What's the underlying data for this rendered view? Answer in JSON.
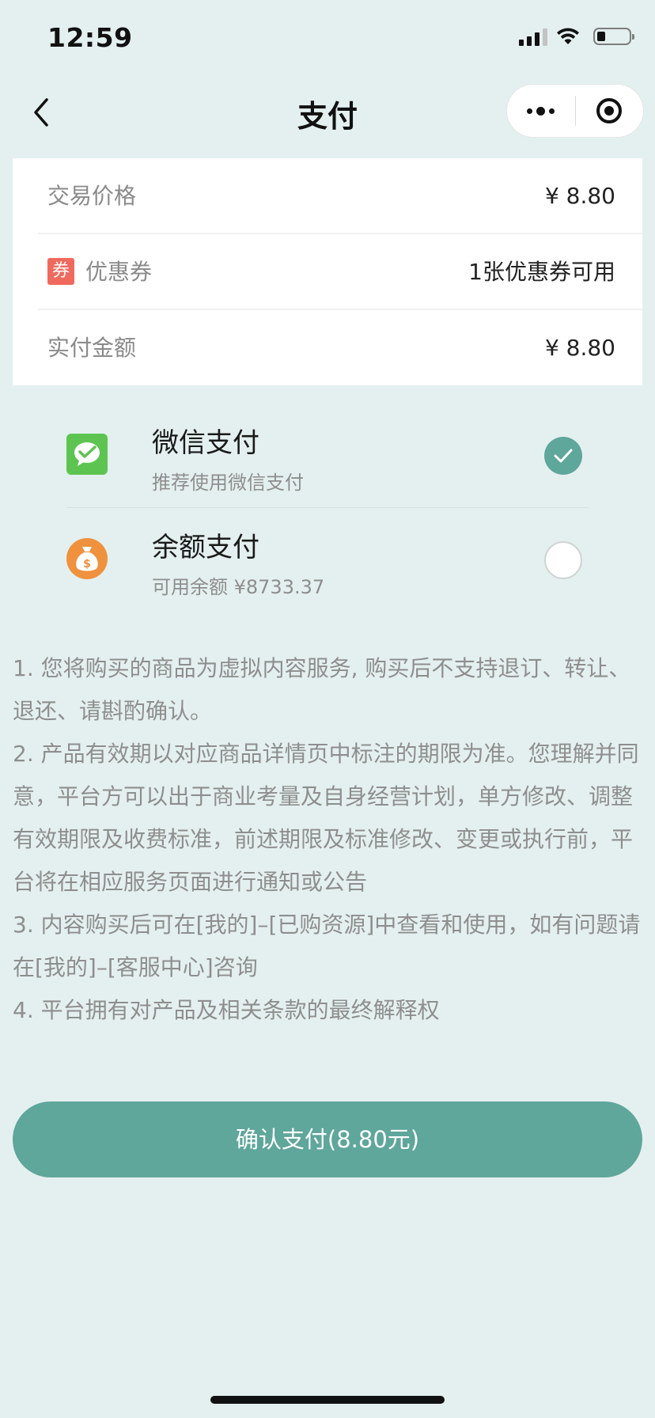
{
  "status_bar": {
    "time": "12:59"
  },
  "nav": {
    "title": "支付"
  },
  "price_card": {
    "trade_price_label": "交易价格",
    "trade_price_value": "¥ 8.80",
    "coupon_badge": "券",
    "coupon_label": "优惠券",
    "coupon_value": "1张优惠券可用",
    "actual_label": "实付金额",
    "actual_value": "¥ 8.80"
  },
  "payment_methods": [
    {
      "title": "微信支付",
      "subtitle": "推荐使用微信支付",
      "icon": "wechat-pay-icon",
      "selected": true
    },
    {
      "title": "余额支付",
      "subtitle": "可用余额 ¥8733.37",
      "icon": "money-bag-icon",
      "selected": false
    }
  ],
  "notes": [
    "1. 您将购买的商品为虚拟内容服务, 购买后不支持退订、转让、退还、请斟酌确认。",
    "2. 产品有效期以对应商品详情页中标注的期限为准。您理解并同意，平台方可以出于商业考量及自身经营计划，单方修改、调整有效期限及收费标准，前述期限及标准修改、变更或执行前，平台将在相应服务页面进行通知或公告",
    "3. 内容购买后可在[我的]–[已购资源]中查看和使用，如有问题请在[我的]–[客服中心]咨询",
    "4. 平台拥有对产品及相关条款的最终解释权"
  ],
  "confirm_button": {
    "label": "确认支付(8.80元)"
  },
  "colors": {
    "background": "#e4f0ef",
    "accent": "#5fa69b",
    "coupon_red": "#f0695e",
    "wechat_green": "#5dc451",
    "balance_orange": "#f0913e"
  }
}
